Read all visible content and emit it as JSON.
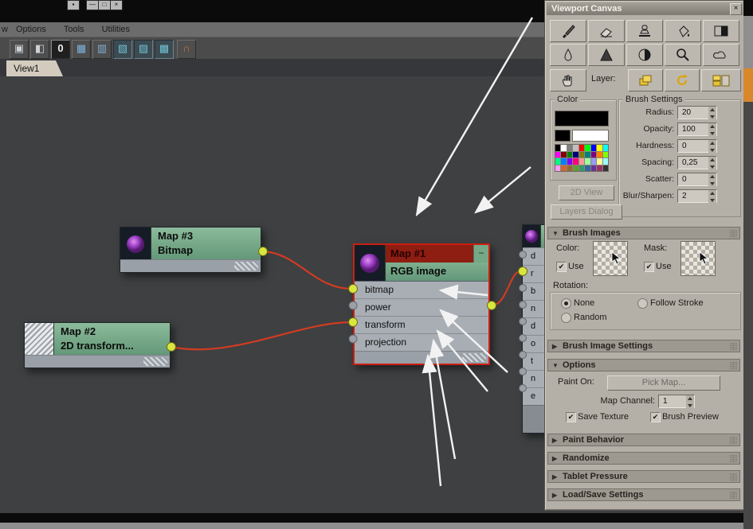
{
  "window": {
    "buttons": [
      "▪",
      "—",
      "□",
      "×"
    ],
    "menu_partial": "w",
    "menu": [
      "Options",
      "Tools",
      "Utilities"
    ],
    "tab": "View1"
  },
  "toolbar": {
    "items": [
      {
        "name": "node-preview",
        "glyph": "▣"
      },
      {
        "name": "node-frame",
        "glyph": "◧"
      },
      {
        "name": "zero-badge",
        "glyph": "0"
      },
      {
        "name": "grid-blue",
        "glyph": "▦"
      },
      {
        "name": "grid-columns",
        "glyph": "▥"
      },
      {
        "name": "layout-left",
        "glyph": "▧"
      },
      {
        "name": "layout-right",
        "glyph": "▨"
      },
      {
        "name": "layout-grid",
        "glyph": "▩"
      },
      {
        "name": "magnet",
        "glyph": "∩"
      }
    ]
  },
  "nodes": {
    "map3": {
      "title": "Map #3",
      "subtitle": "Bitmap"
    },
    "map2": {
      "title": "Map #2",
      "subtitle": "2D transform..."
    },
    "map1": {
      "title": "Map #1",
      "subtitle": "RGB image",
      "slots": [
        "bitmap",
        "power",
        "transform",
        "projection"
      ]
    },
    "clipped": {
      "slots": [
        "d",
        "r",
        "b",
        "n",
        "d",
        "o",
        "t",
        "n",
        "e"
      ]
    }
  },
  "panel": {
    "title": "Viewport Canvas",
    "layer_label": "Layer:",
    "color": {
      "label": "Color",
      "palette": [
        "#000000",
        "#ffffff",
        "#7f7f7f",
        "#c0c0c0",
        "#ff0000",
        "#00ff00",
        "#0000ff",
        "#ffff00",
        "#00ffff",
        "#ff00ff",
        "#7f0000",
        "#007f00",
        "#00007f",
        "#7f7f00",
        "#007f7f",
        "#7f007f",
        "#ff7f00",
        "#7fff00",
        "#00ff7f",
        "#007fff",
        "#7f00ff",
        "#ff007f",
        "#ff9999",
        "#99ff99",
        "#9999ff",
        "#ffff99",
        "#99ffff",
        "#ff99ff",
        "#cc6633",
        "#996633",
        "#669933",
        "#339966",
        "#336699",
        "#663399",
        "#993366",
        "#333333"
      ]
    },
    "brush_settings": {
      "label": "Brush Settings",
      "rows": [
        {
          "label": "Radius:",
          "value": "20"
        },
        {
          "label": "Opacity:",
          "value": "100"
        },
        {
          "label": "Hardness:",
          "value": "0"
        },
        {
          "label": "Spacing:",
          "value": "0,25"
        },
        {
          "label": "Scatter:",
          "value": "0"
        },
        {
          "label": "Blur/Sharpen:",
          "value": "2"
        }
      ]
    },
    "view2d_button": "2D View",
    "layers_dialog_button": "Layers Dialog",
    "brush_images": {
      "header": "Brush Images",
      "color_label": "Color:",
      "mask_label": "Mask:",
      "use_label": "Use",
      "rotation_label": "Rotation:",
      "none_label": "None",
      "random_label": "Random",
      "follow_label": "Follow Stroke"
    },
    "brush_image_settings_header": "Brush Image Settings",
    "options": {
      "header": "Options",
      "paint_on_label": "Paint On:",
      "pick_map_button": "Pick Map...",
      "map_channel_label": "Map Channel:",
      "map_channel_value": "1",
      "save_texture_label": "Save Texture",
      "brush_preview_label": "Brush Preview"
    },
    "collapsed_rollouts": [
      "Paint Behavior",
      "Randomize",
      "Tablet Pressure",
      "Load/Save Settings"
    ]
  },
  "icons": {
    "close": "×",
    "minus": "−",
    "arrow_down": "▼",
    "arrow_right": "▶",
    "check": "✔",
    "grip": "⣿⣿"
  }
}
